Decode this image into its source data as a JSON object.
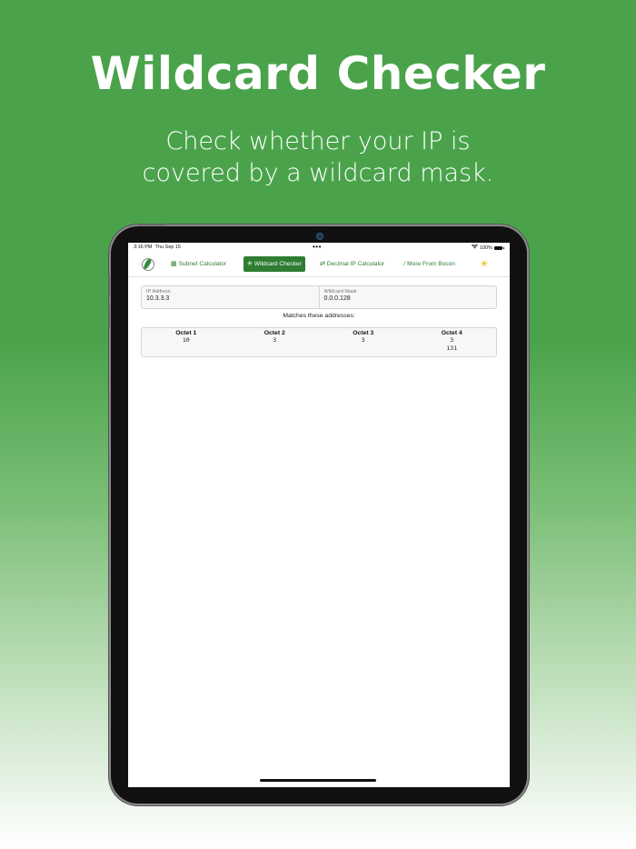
{
  "promo": {
    "title": "Wildcard Checker",
    "subtitle_line1": "Check whether your IP is",
    "subtitle_line2": "covered by a wildcard mask."
  },
  "statusbar": {
    "time": "3:16 PM",
    "date": "Thu Sep 15",
    "dots": "•••",
    "battery": "100%"
  },
  "nav": {
    "tabs": [
      {
        "label": "Subnet Calculator",
        "icon": "calculator-icon"
      },
      {
        "label": "Wildcard Checker",
        "icon": "asterisk-icon"
      },
      {
        "label": "Decimal IP Calculator",
        "icon": "swap-arrows-icon"
      },
      {
        "label": "More From Boson",
        "icon": "boson-leaf-icon"
      }
    ],
    "active_tab": "Wildcard Checker",
    "theme_icon": "sun-icon"
  },
  "form": {
    "ip_label": "IP Address",
    "ip_value": "10.3.3.3",
    "mask_label": "Wildcard Mask",
    "mask_value": "0.0.0.128"
  },
  "results": {
    "heading": "Matches these addresses:",
    "octets": [
      {
        "header": "Octet 1",
        "values": [
          "10"
        ]
      },
      {
        "header": "Octet 2",
        "values": [
          "3"
        ]
      },
      {
        "header": "Octet 3",
        "values": [
          "3"
        ]
      },
      {
        "header": "Octet 4",
        "values": [
          "3",
          "131"
        ]
      }
    ]
  },
  "colors": {
    "background_green": "#4aa34b",
    "accent": "#2e7d32"
  }
}
